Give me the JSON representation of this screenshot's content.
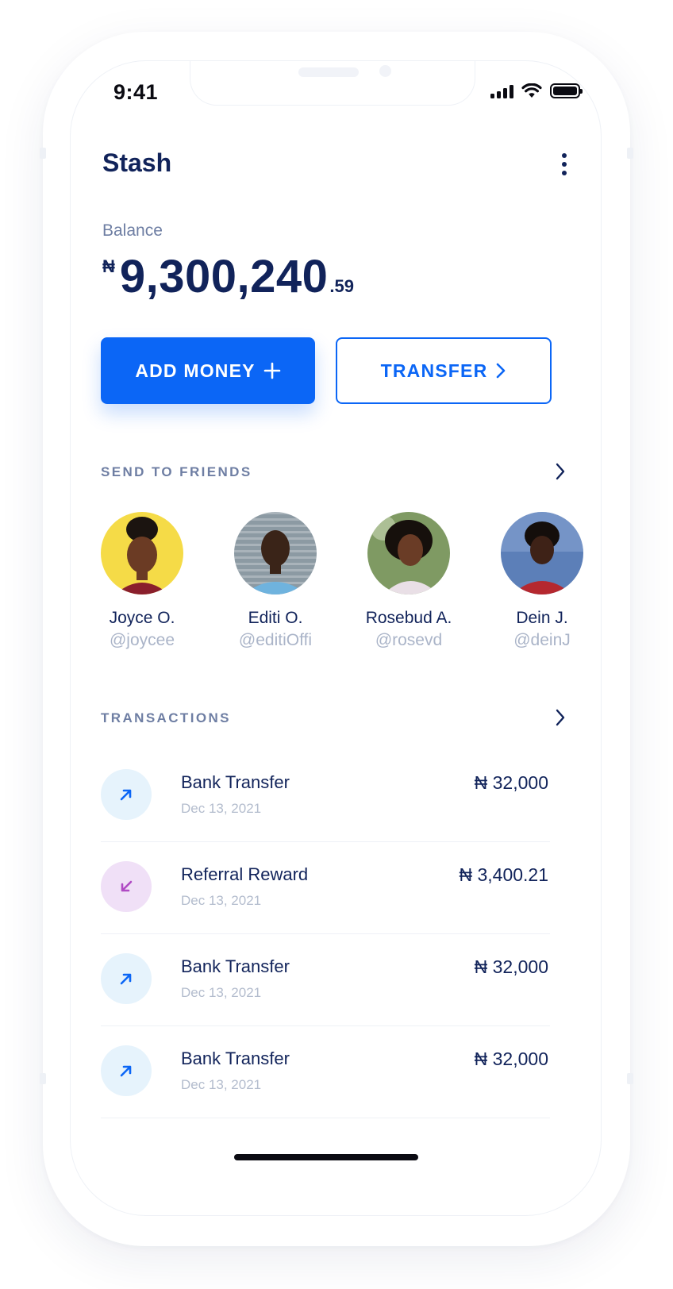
{
  "status_bar": {
    "time": "9:41"
  },
  "header": {
    "title": "Stash"
  },
  "balance": {
    "label": "Balance",
    "currency_symbol": "₦",
    "whole": "9,300,240",
    "decimal": ".59"
  },
  "actions": {
    "add_money_label": "ADD MONEY",
    "transfer_label": "TRANSFER"
  },
  "friends_section": {
    "title": "SEND TO FRIENDS",
    "friends": [
      {
        "name": "Joyce O.",
        "handle": "@joycee",
        "bg": "#f5db47"
      },
      {
        "name": "Editi O.",
        "handle": "@editiOffi",
        "bg": "#8c9aa3"
      },
      {
        "name": "Rosebud A.",
        "handle": "@rosevd",
        "bg": "#7f9a63"
      },
      {
        "name": "Dein J.",
        "handle": "@deinJ",
        "bg": "#5c7fb8"
      }
    ]
  },
  "transactions_section": {
    "title": "TRANSACTIONS",
    "items": [
      {
        "title": "Bank Transfer",
        "date": "Dec 13, 2021",
        "amount": "₦ 32,000",
        "icon": "arrow-up-right-icon"
      },
      {
        "title": "Referral Reward",
        "date": "Dec 13, 2021",
        "amount": "₦ 3,400.21",
        "icon": "arrow-down-left-icon"
      },
      {
        "title": "Bank Transfer",
        "date": "Dec 13, 2021",
        "amount": "₦ 32,000",
        "icon": "arrow-up-right-icon"
      },
      {
        "title": "Bank Transfer",
        "date": "Dec 13, 2021",
        "amount": "₦ 32,000",
        "icon": "arrow-up-right-icon"
      }
    ]
  },
  "colors": {
    "primary": "#0b66f6",
    "text_dark": "#11235a",
    "text_muted": "#6e7ea3",
    "outgoing_icon_bg": "#e6f3fc",
    "incoming_icon_bg": "#f0e0f7",
    "incoming_icon_color": "#b04ac4"
  }
}
